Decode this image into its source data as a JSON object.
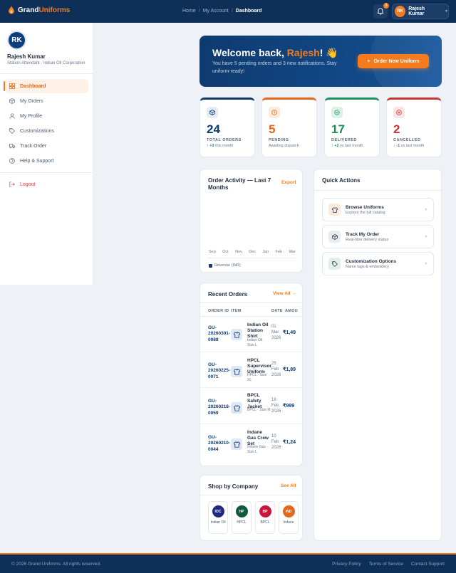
{
  "brand": {
    "name_part1": "Grand",
    "name_part2": "Uniforms"
  },
  "breadcrumb": [
    "Home",
    "My Account",
    "Dashboard"
  ],
  "notifications": {
    "count": "3"
  },
  "user": {
    "initials": "RK",
    "name": "Rajesh Kumar",
    "role": "Station Attendant · Indian Oil Corporation"
  },
  "sidebar": {
    "items": [
      {
        "label": "Dashboard",
        "icon": "dashboard-icon",
        "active": true
      },
      {
        "label": "My Orders",
        "icon": "box-icon"
      },
      {
        "label": "My Profile",
        "icon": "user-icon"
      },
      {
        "label": "Customizations",
        "icon": "tag-icon"
      },
      {
        "label": "Track Order",
        "icon": "truck-icon"
      },
      {
        "label": "Help & Support",
        "icon": "help-icon"
      }
    ],
    "logout": "Logout"
  },
  "welcome": {
    "title_prefix": "Welcome back, ",
    "title_name": "Rajesh",
    "title_suffix": "! 👋",
    "subtitle": "You have 5 pending orders and 3 new notifications. Stay uniform-ready!",
    "button": "Order New Uniform"
  },
  "stats": [
    {
      "value": "24",
      "label": "TOTAL ORDERS",
      "delta": "↑ +3",
      "note": " this month",
      "color": "#0e3a6e",
      "trend": "up"
    },
    {
      "value": "5",
      "label": "PENDING",
      "delta": "",
      "note": "Awaiting dispatch",
      "color": "#e5661a",
      "trend": "none"
    },
    {
      "value": "17",
      "label": "DELIVERED",
      "delta": "↑ +2",
      "note": " vs last month",
      "color": "#1a8f5a",
      "trend": "up"
    },
    {
      "value": "2",
      "label": "CANCELLED",
      "delta": "↓ -1",
      "note": " vs last month",
      "color": "#c83434",
      "trend": "down"
    }
  ],
  "activity": {
    "title": "Order Activity — Last 7 Months",
    "export": "Export",
    "months": [
      "Sep",
      "Oct",
      "Nov",
      "Dec",
      "Jan",
      "Feb",
      "Mar"
    ],
    "legend": "Revenue (INR)"
  },
  "quick": {
    "title": "Quick Actions",
    "items": [
      {
        "title": "Browse Uniforms",
        "sub": "Explore the full catalog",
        "icon": "shirt-icon"
      },
      {
        "title": "Track My Order",
        "sub": "Real-time delivery status",
        "icon": "box-icon"
      },
      {
        "title": "Customization Options",
        "sub": "Name tags & embroidery",
        "icon": "tag-icon"
      }
    ]
  },
  "recent": {
    "title": "Recent Orders",
    "view_all": "View All →",
    "columns": [
      "ORDER ID",
      "ITEM",
      "DATE",
      "AMOU"
    ],
    "rows": [
      {
        "id": "GU-20260301-0088",
        "item": "Indian Oil Station Shirt",
        "meta": "Indian Oil · Size L",
        "date": "01 Mar 2026",
        "amount": "₹1,49"
      },
      {
        "id": "GU-20260225-0071",
        "item": "HPCL Supervisor Uniform",
        "meta": "HPCL · Size XL",
        "date": "25 Feb 2026",
        "amount": "₹1,89"
      },
      {
        "id": "GU-20260218-0059",
        "item": "BPCL Safety Jacket",
        "meta": "BPCL · Size M",
        "date": "18 Feb 2026",
        "amount": "₹999"
      },
      {
        "id": "GU-20260210-0044",
        "item": "Indane Gas Crew Set",
        "meta": "Indane Gas · Size L",
        "date": "10 Feb 2026",
        "amount": "₹1,24"
      }
    ]
  },
  "shop": {
    "title": "Shop by Company",
    "see_all": "See All",
    "companies": [
      {
        "abbr": "IOC",
        "name": "Indian Oil",
        "color": "#1f2a80"
      },
      {
        "abbr": "HP",
        "name": "HPCL",
        "color": "#0f5a3a"
      },
      {
        "abbr": "BP",
        "name": "BPCL",
        "color": "#c8163c"
      },
      {
        "abbr": "IND",
        "name": "Indane",
        "color": "#e5661a"
      }
    ]
  },
  "footer": {
    "copyright": "© 2026 Grand Uniforms. All rights reserved.",
    "links": [
      "Privacy Policy",
      "Terms of Service",
      "Contact Support"
    ]
  }
}
